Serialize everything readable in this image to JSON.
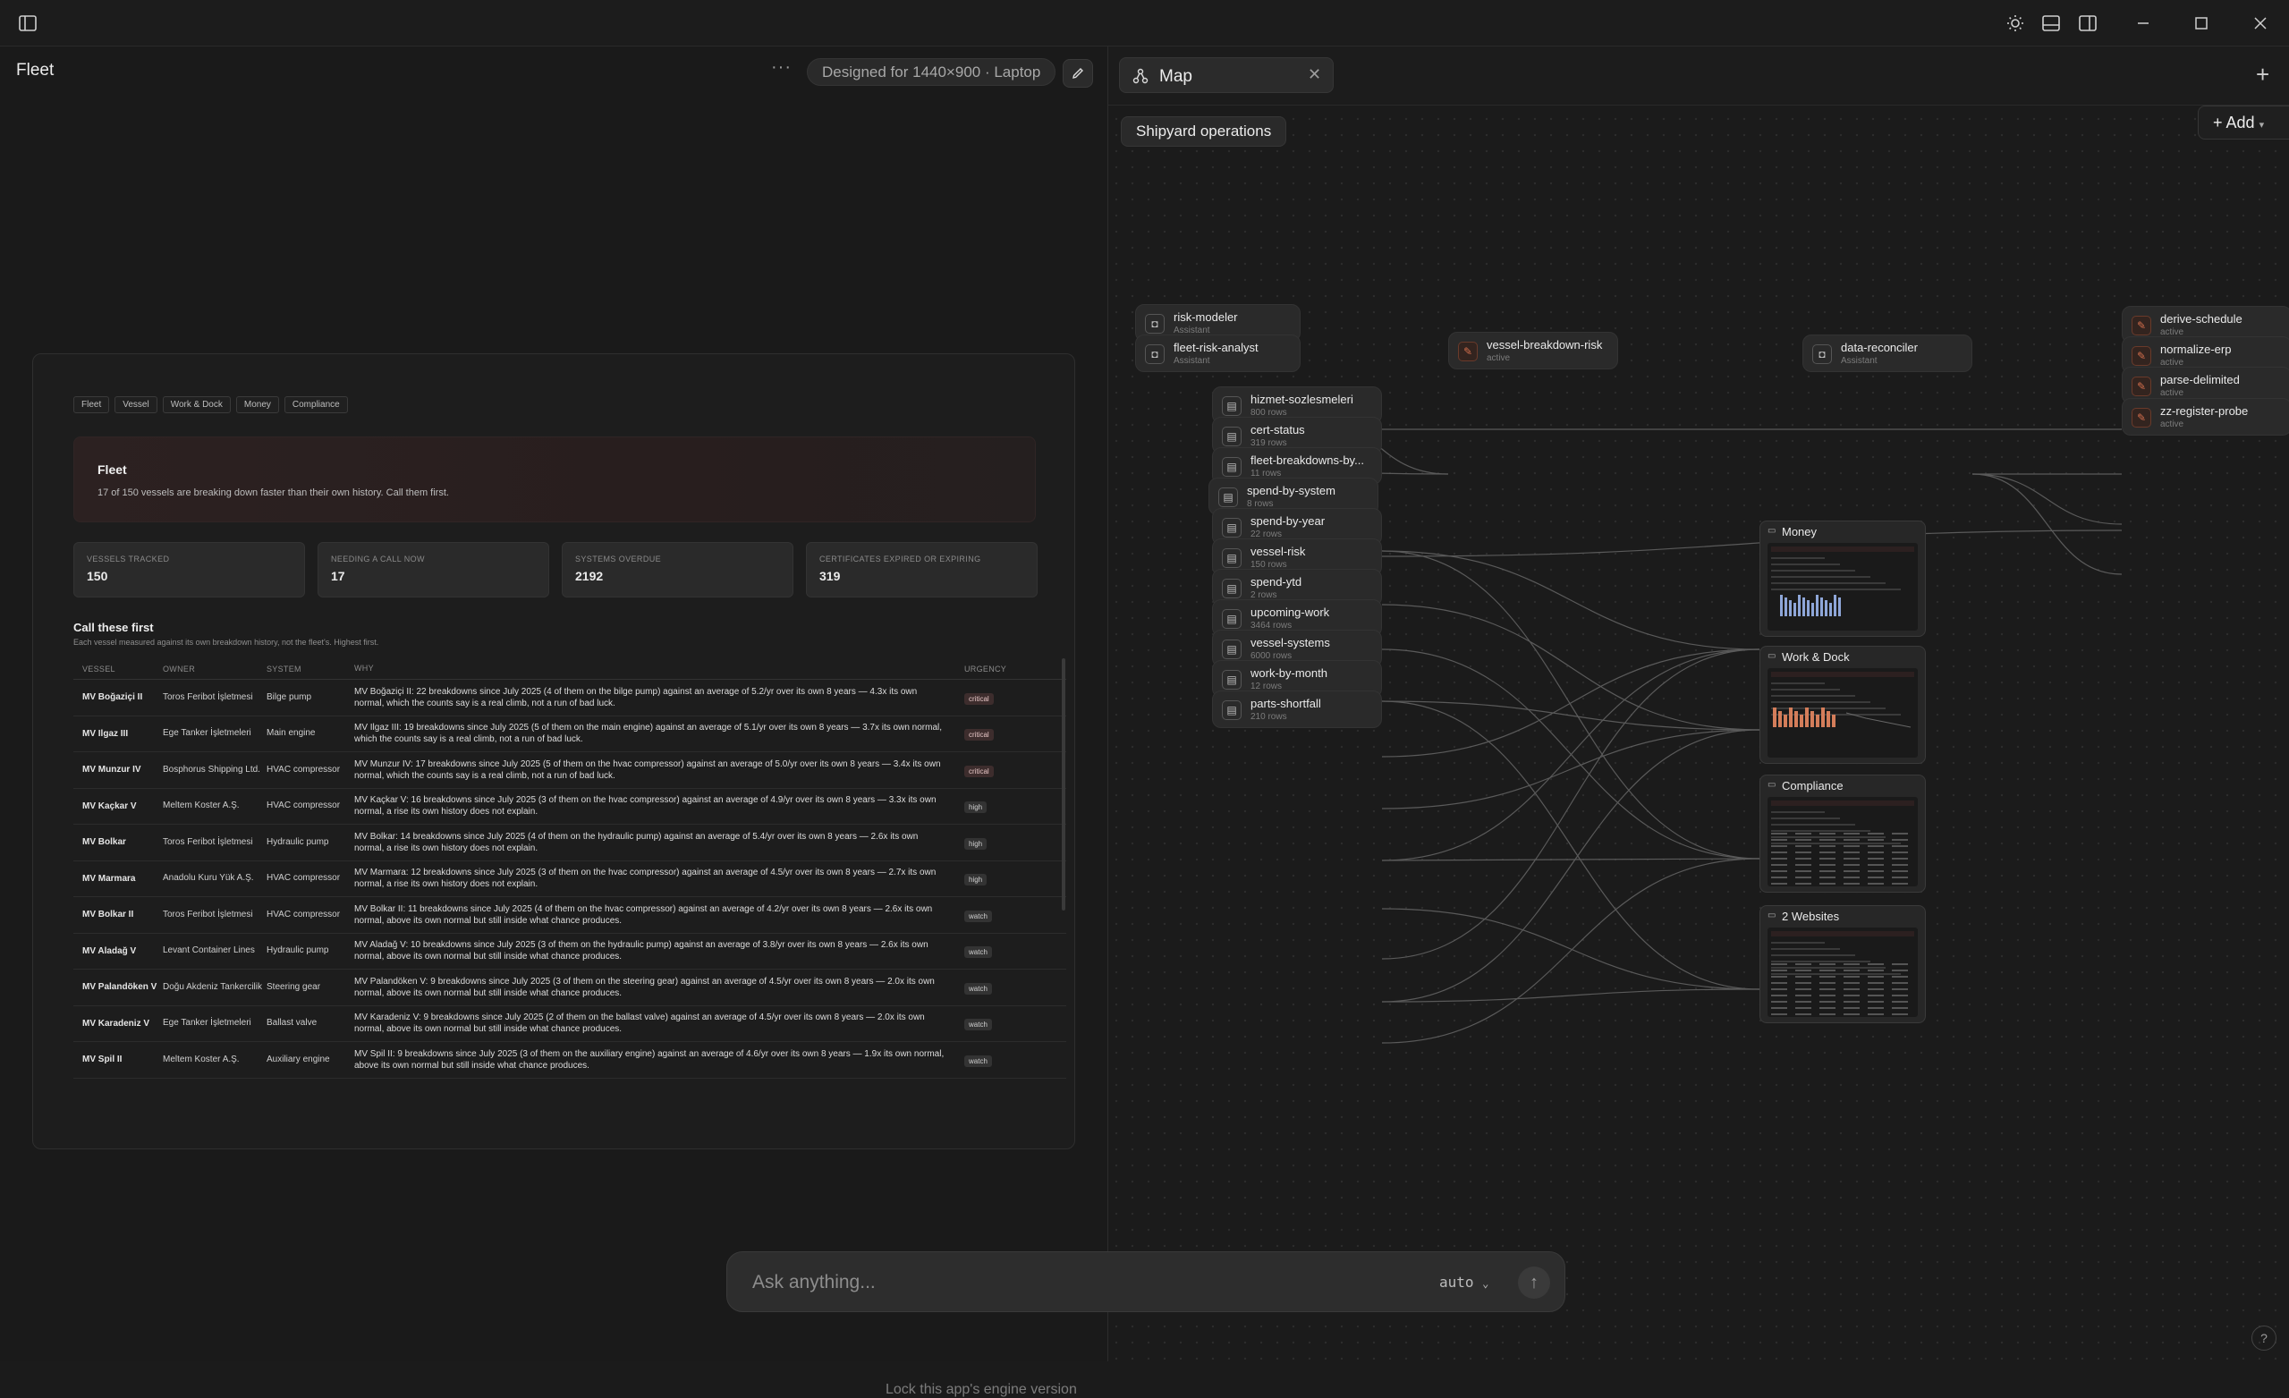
{
  "left": {
    "title": "Fleet",
    "more": "···",
    "designed": "Designed for 1440×900 · Laptop",
    "lock": "Lock this app's engine version"
  },
  "preview": {
    "chips": [
      "Fleet",
      "Vessel",
      "Work & Dock",
      "Money",
      "Compliance"
    ],
    "hero_title": "Fleet",
    "hero_sub": "17 of 150 vessels are breaking down faster than their own history. Call them first.",
    "stats": [
      {
        "label": "VESSELS TRACKED",
        "value": "150"
      },
      {
        "label": "NEEDING A CALL NOW",
        "value": "17"
      },
      {
        "label": "SYSTEMS OVERDUE",
        "value": "2192"
      },
      {
        "label": "CERTIFICATES EXPIRED OR EXPIRING",
        "value": "319"
      }
    ],
    "section_title": "Call these first",
    "section_sub": "Each vessel measured against its own breakdown history, not the fleet's. Highest first.",
    "headers": [
      "VESSEL",
      "OWNER",
      "SYSTEM",
      "WHY",
      "URGENCY"
    ],
    "rows": [
      [
        "MV Boğaziçi II",
        "Toros Feribot İşletmesi",
        "Bilge pump",
        "MV Boğaziçi II: 22 breakdowns since July 2025 (4 of them on the bilge pump) against an average of 5.2/yr over its own 8 years — 4.3x its own normal, which the counts say is a real climb, not a run of bad luck.",
        "critical"
      ],
      [
        "MV Ilgaz III",
        "Ege Tanker İşletmeleri",
        "Main engine",
        "MV Ilgaz III: 19 breakdowns since July 2025 (5 of them on the main engine) against an average of 5.1/yr over its own 8 years — 3.7x its own normal, which the counts say is a real climb, not a run of bad luck.",
        "critical"
      ],
      [
        "MV Munzur IV",
        "Bosphorus Shipping Ltd.",
        "HVAC compressor",
        "MV Munzur IV: 17 breakdowns since July 2025 (5 of them on the hvac compressor) against an average of 5.0/yr over its own 8 years — 3.4x its own normal, which the counts say is a real climb, not a run of bad luck.",
        "critical"
      ],
      [
        "MV Kaçkar V",
        "Meltem Koster A.Ş.",
        "HVAC compressor",
        "MV Kaçkar V: 16 breakdowns since July 2025 (3 of them on the hvac compressor) against an average of 4.9/yr over its own 8 years — 3.3x its own normal, a rise its own history does not explain.",
        "high"
      ],
      [
        "MV Bolkar",
        "Toros Feribot İşletmesi",
        "Hydraulic pump",
        "MV Bolkar: 14 breakdowns since July 2025 (4 of them on the hydraulic pump) against an average of 5.4/yr over its own 8 years — 2.6x its own normal, a rise its own history does not explain.",
        "high"
      ],
      [
        "MV Marmara",
        "Anadolu Kuru Yük A.Ş.",
        "HVAC compressor",
        "MV Marmara: 12 breakdowns since July 2025 (3 of them on the hvac compressor) against an average of 4.5/yr over its own 8 years — 2.7x its own normal, a rise its own history does not explain.",
        "high"
      ],
      [
        "MV Bolkar II",
        "Toros Feribot İşletmesi",
        "HVAC compressor",
        "MV Bolkar II: 11 breakdowns since July 2025 (4 of them on the hvac compressor) against an average of 4.2/yr over its own 8 years — 2.6x its own normal, above its own normal but still inside what chance produces.",
        "watch"
      ],
      [
        "MV Aladağ V",
        "Levant Container Lines",
        "Hydraulic pump",
        "MV Aladağ V: 10 breakdowns since July 2025 (3 of them on the hydraulic pump) against an average of 3.8/yr over its own 8 years — 2.6x its own normal, above its own normal but still inside what chance produces.",
        "watch"
      ],
      [
        "MV Palandöken V",
        "Doğu Akdeniz Tankercilik",
        "Steering gear",
        "MV Palandöken V: 9 breakdowns since July 2025 (3 of them on the steering gear) against an average of 4.5/yr over its own 8 years — 2.0x its own normal, above its own normal but still inside what chance produces.",
        "watch"
      ],
      [
        "MV Karadeniz V",
        "Ege Tanker İşletmeleri",
        "Ballast valve",
        "MV Karadeniz V: 9 breakdowns since July 2025 (2 of them on the ballast valve) against an average of 4.5/yr over its own 8 years — 2.0x its own normal, above its own normal but still inside what chance produces.",
        "watch"
      ],
      [
        "MV Spil II",
        "Meltem Koster A.Ş.",
        "Auxiliary engine",
        "MV Spil II: 9 breakdowns since July 2025 (3 of them on the auxiliary engine) against an average of 4.6/yr over its own 8 years — 1.9x its own normal, above its own normal but still inside what chance produces.",
        "watch"
      ]
    ]
  },
  "ask": {
    "placeholder": "Ask anything...",
    "mode": "auto"
  },
  "right": {
    "tab_label": "Map",
    "breadcrumb": "Shipyard operations",
    "add_label": "+ Add",
    "nodes": [
      {
        "name": "risk-modeler",
        "sub": "Assistant",
        "kind": "assistant"
      },
      {
        "name": "fleet-risk-analyst",
        "sub": "Assistant",
        "kind": "assistant"
      },
      {
        "name": "vessel-breakdown-risk",
        "sub": "active",
        "kind": "tool"
      },
      {
        "name": "data-reconciler",
        "sub": "Assistant",
        "kind": "assistant"
      },
      {
        "name": "derive-schedule",
        "sub": "active",
        "kind": "tool"
      },
      {
        "name": "normalize-erp",
        "sub": "active",
        "kind": "tool"
      },
      {
        "name": "parse-delimited",
        "sub": "active",
        "kind": "tool"
      },
      {
        "name": "zz-register-probe",
        "sub": "active",
        "kind": "tool"
      },
      {
        "name": "hizmet-sozlesmeleri",
        "sub": "800 rows",
        "kind": "table"
      },
      {
        "name": "cert-status",
        "sub": "319 rows",
        "kind": "table"
      },
      {
        "name": "fleet-breakdowns-by...",
        "sub": "11 rows",
        "kind": "table"
      },
      {
        "name": "spend-by-system",
        "sub": "8 rows",
        "kind": "table"
      },
      {
        "name": "spend-by-year",
        "sub": "22 rows",
        "kind": "table"
      },
      {
        "name": "vessel-risk",
        "sub": "150 rows",
        "kind": "table"
      },
      {
        "name": "spend-ytd",
        "sub": "2 rows",
        "kind": "table"
      },
      {
        "name": "upcoming-work",
        "sub": "3464 rows",
        "kind": "table"
      },
      {
        "name": "vessel-systems",
        "sub": "6000 rows",
        "kind": "table"
      },
      {
        "name": "work-by-month",
        "sub": "12 rows",
        "kind": "table"
      },
      {
        "name": "parts-shortfall",
        "sub": "210 rows",
        "kind": "table"
      }
    ],
    "cards": [
      "Money",
      "Work & Dock",
      "Compliance",
      "2 Websites"
    ]
  },
  "colors": {
    "accent": "#d46f4d",
    "critical": "#3d2d2d",
    "background": "#1b1b1b"
  }
}
